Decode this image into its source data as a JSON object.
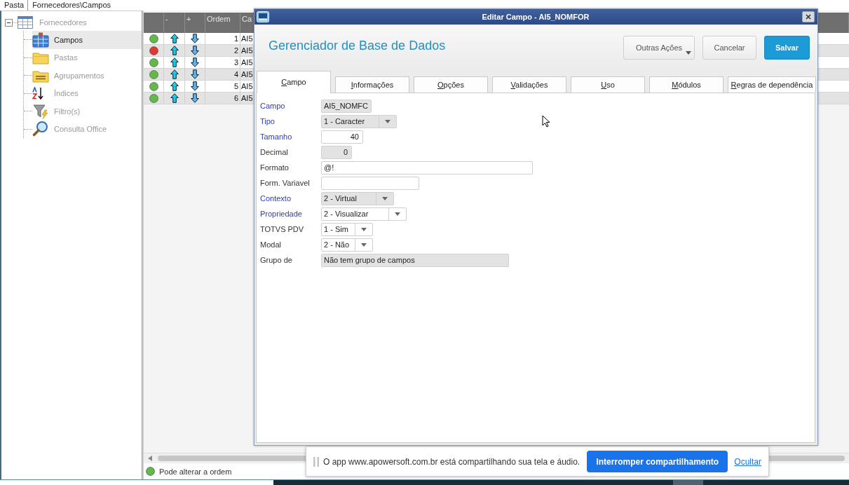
{
  "top_bar": {
    "label": "Pasta",
    "path": "Fornecedores\\Campos"
  },
  "tree": [
    {
      "label": "Fornecedores",
      "selected": false,
      "expanded": true,
      "children": [
        {
          "label": "Campos",
          "selected": true
        },
        {
          "label": "Pastas",
          "selected": false
        },
        {
          "label": "Agrupamentos",
          "selected": false
        },
        {
          "label": "Índices",
          "selected": false
        },
        {
          "label": "Filtro(s)",
          "selected": false
        },
        {
          "label": "Consulta Office",
          "selected": false
        }
      ]
    }
  ],
  "grid": {
    "columns": [
      "-",
      "+",
      "Ordem",
      "Ca"
    ],
    "rows": [
      {
        "color": "#62b94a",
        "ordem": "1",
        "column_5": "AI5"
      },
      {
        "color": "#d93b35",
        "ordem": "2",
        "column_5": "AI5"
      },
      {
        "color": "#62b94a",
        "ordem": "3",
        "column_5": "AI5"
      },
      {
        "color": "#62b94a",
        "ordem": "4",
        "column_5": "AI5"
      },
      {
        "color": "#62b94a",
        "ordem": "5",
        "column_5": "AI5"
      },
      {
        "color": "#62b94a",
        "ordem": "6",
        "column_5": "AI5"
      }
    ]
  },
  "legend": [
    {
      "color": "#62b94a",
      "label": "Pode alterar a ordem"
    }
  ],
  "dialog": {
    "title": "Editar Campo - AI5_NOMFOR",
    "heading": "Gerenciador de Base de Dados",
    "buttons": [
      {
        "label": "Outras Ações",
        "kind": "menu"
      },
      {
        "label": "Cancelar",
        "kind": "secondary"
      },
      {
        "label": "Salvar",
        "kind": "primary"
      }
    ],
    "tabs": [
      {
        "label": "Campo",
        "selected": true
      },
      {
        "label": "Informações",
        "selected": false
      },
      {
        "label": "Opções",
        "selected": false
      },
      {
        "label": "Validações",
        "selected": false
      },
      {
        "label": "Uso",
        "selected": false
      },
      {
        "label": "Módulos",
        "selected": false
      },
      {
        "label": "Regras de dependência",
        "selected": false
      }
    ],
    "fields": [
      {
        "label": "Campo",
        "required": true,
        "kind": "text",
        "value": "AI5_NOMFC",
        "disabled": true
      },
      {
        "label": "Tipo",
        "required": true,
        "kind": "select",
        "value": "1 - Caracter",
        "disabled": true
      },
      {
        "label": "Tamanho",
        "required": true,
        "kind": "number",
        "value": "40",
        "disabled": false
      },
      {
        "label": "Decimal",
        "required": false,
        "kind": "number",
        "value": "0",
        "disabled": true
      },
      {
        "label": "Formato",
        "required": false,
        "kind": "text",
        "value": "@!",
        "disabled": false
      },
      {
        "label": "Form. Variavel",
        "required": false,
        "kind": "text",
        "disabled": false
      },
      {
        "label": "Contexto",
        "required": true,
        "kind": "select",
        "value": "2 - Virtual",
        "disabled": true
      },
      {
        "label": "Propriedade",
        "required": true,
        "kind": "select",
        "value": "2 - Visualizar",
        "disabled": false
      },
      {
        "label": "TOTVS PDV",
        "required": false,
        "kind": "select",
        "value": "1 - Sim",
        "disabled": false
      },
      {
        "label": "Modal",
        "required": false,
        "kind": "select",
        "value": "2 - Não",
        "disabled": false
      },
      {
        "label": "Grupo de",
        "required": false,
        "kind": "text",
        "value": "Não tem grupo de campos",
        "disabled": true
      }
    ]
  },
  "share_bar": {
    "text": "O app www.apowersoft.com.br está compartilhando sua tela e áudio.",
    "button": "Interromper compartilhamento",
    "link": "Ocultar"
  }
}
